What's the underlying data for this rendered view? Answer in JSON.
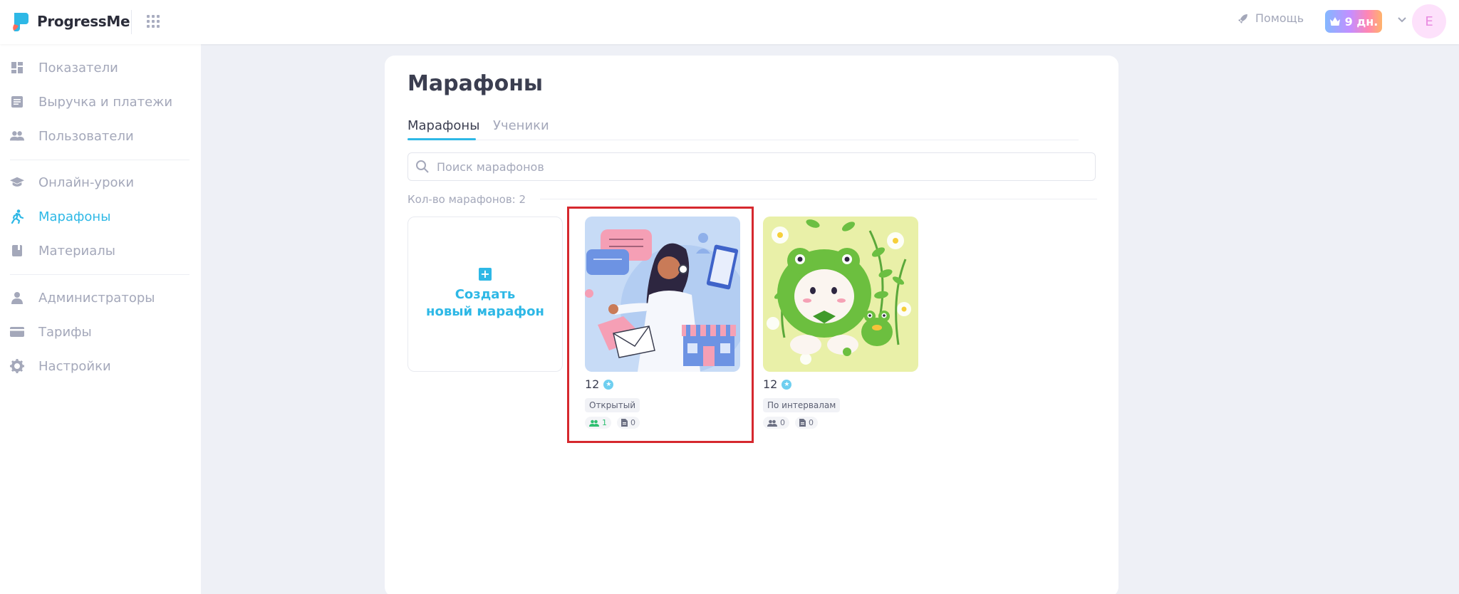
{
  "app": {
    "name": "ProgressMe"
  },
  "header": {
    "help_label": "Помощь",
    "trial_label": "9 дн.",
    "avatar_letter": "E"
  },
  "sidebar": {
    "items": [
      {
        "label": "Показатели",
        "icon": "dashboard-icon"
      },
      {
        "label": "Выручка и платежи",
        "icon": "receipt-icon"
      },
      {
        "label": "Пользователи",
        "icon": "users-icon"
      },
      {
        "label": "Онлайн-уроки",
        "icon": "graduation-cap-icon"
      },
      {
        "label": "Марафоны",
        "icon": "runner-icon",
        "active": true
      },
      {
        "label": "Материалы",
        "icon": "book-icon"
      },
      {
        "label": "Администраторы",
        "icon": "person-icon"
      },
      {
        "label": "Тарифы",
        "icon": "card-icon"
      },
      {
        "label": "Настройки",
        "icon": "gear-icon"
      }
    ]
  },
  "main": {
    "title": "Марафоны",
    "tabs": [
      {
        "label": "Марафоны",
        "active": true
      },
      {
        "label": "Ученики"
      }
    ],
    "search": {
      "placeholder": "Поиск марафонов",
      "value": ""
    },
    "count_label": "Кол-во марафонов: 2",
    "create_label": "Создать\nновый марафон",
    "marathons": [
      {
        "name": "12",
        "type": "Открытый",
        "students": "1",
        "materials": "0"
      },
      {
        "name": "12",
        "type": "По интервалам",
        "students": "0",
        "materials": "0"
      }
    ]
  },
  "colors": {
    "accent": "#2eb8e6",
    "highlight": "#d6282e"
  }
}
